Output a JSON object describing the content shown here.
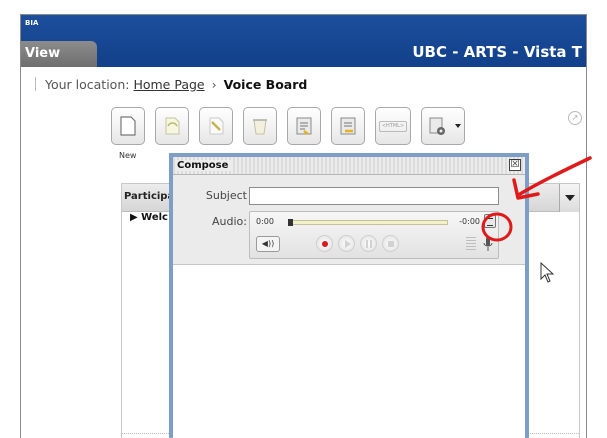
{
  "header": {
    "brand": "BIA",
    "view_tab": "View",
    "site_title": "UBC - ARTS - Vista T"
  },
  "breadcrumb": {
    "prefix": "Your location:",
    "home": "Home Page",
    "separator": "›",
    "current": "Voice Board"
  },
  "toolbar": {
    "new_label": "New",
    "buttons": [
      "new-icon",
      "reply-icon",
      "edit-icon",
      "delete-icon",
      "import-icon",
      "export-icon",
      "html-icon",
      "settings-icon"
    ],
    "html_badge": "<HTML>"
  },
  "panel": {
    "title": "Participa",
    "row": "Welc"
  },
  "dialog": {
    "title": "Compose",
    "close_glyph": "☒",
    "subject_label": "Subject",
    "subject_value": "",
    "audio_label": "Audio:",
    "time_start": "0:00",
    "time_end": "-0:00",
    "progress": 0
  },
  "colors": {
    "header_blue": "#1c4f9c",
    "dialog_border": "#7f9ec7",
    "record_red": "#d81b1b",
    "annotation_red": "#e01919"
  }
}
